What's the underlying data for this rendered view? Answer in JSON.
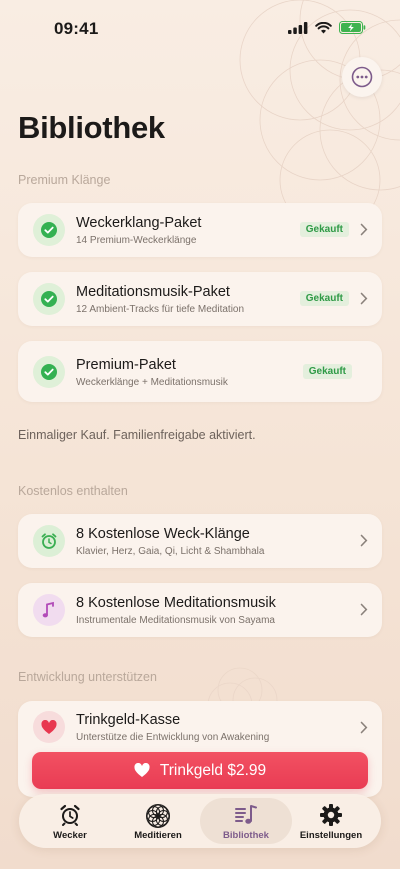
{
  "status_bar": {
    "time": "09:41"
  },
  "header": {
    "title": "Bibliothek",
    "more_icon": "ellipsis-circle-icon"
  },
  "sections": {
    "premium": {
      "label": "Premium Klänge",
      "items": [
        {
          "title": "Weckerklang-Paket",
          "subtitle": "14 Premium-Weckerklänge",
          "badge": "Gekauft",
          "icon": "checkmark-icon"
        },
        {
          "title": "Meditationsmusik-Paket",
          "subtitle": "12 Ambient-Tracks für tiefe Meditation",
          "badge": "Gekauft",
          "icon": "checkmark-icon"
        },
        {
          "title": "Premium-Paket",
          "subtitle": "Weckerklänge + Meditationsmusik",
          "badge": "Gekauft",
          "icon": "checkmark-icon"
        }
      ],
      "footnote": "Einmaliger Kauf. Familienfreigabe aktiviert."
    },
    "free": {
      "label": "Kostenlos enthalten",
      "items": [
        {
          "title": "8 Kostenlose Weck-Klänge",
          "subtitle": "Klavier, Herz, Gaia, Qi, Licht & Shambhala",
          "icon": "alarm-clock-icon"
        },
        {
          "title": "8 Kostenlose Meditationsmusik",
          "subtitle": "Instrumentale Meditationsmusik von Sayama",
          "icon": "music-note-icon"
        }
      ]
    },
    "support": {
      "label": "Entwicklung unterstützen",
      "item": {
        "title": "Trinkgeld-Kasse",
        "subtitle": "Unterstütze die Entwicklung von Awakening",
        "icon": "heart-icon"
      },
      "tip_button": "Trinkgeld $2.99"
    }
  },
  "tab_bar": {
    "active": "Bibliothek",
    "tabs": [
      {
        "label": "Wecker",
        "icon": "alarm-clock-icon"
      },
      {
        "label": "Meditieren",
        "icon": "mandala-icon"
      },
      {
        "label": "Bibliothek",
        "icon": "music-library-icon"
      },
      {
        "label": "Einstellungen",
        "icon": "gear-icon"
      }
    ]
  },
  "colors": {
    "background": "#f7e9de",
    "accent_purple": "#7d5b8b",
    "success_green": "#2f9a46",
    "tip_red": "#ea3e55",
    "card": "#fbf3ed"
  }
}
